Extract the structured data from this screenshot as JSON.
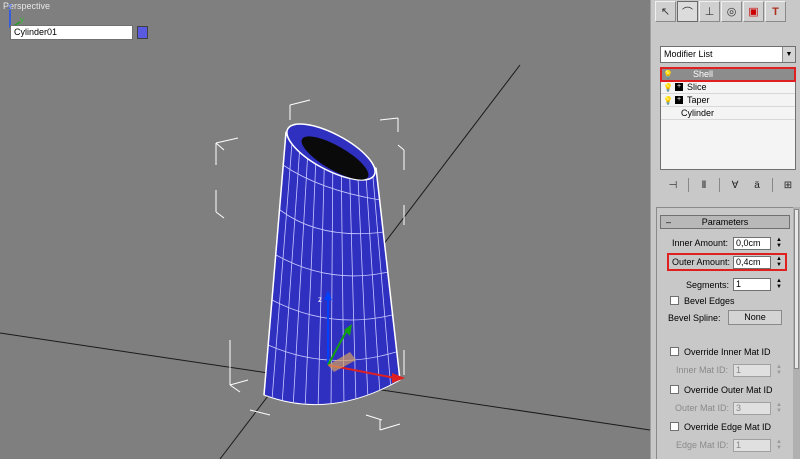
{
  "viewport": {
    "label": "Perspective",
    "axes": {
      "x": "x",
      "y": "y",
      "z": "z"
    }
  },
  "command_panel": {
    "tabs": [
      {
        "name": "create",
        "icon": "cursor-icon"
      },
      {
        "name": "modify",
        "icon": "bend-icon"
      },
      {
        "name": "hierarchy",
        "icon": "hierarchy-icon"
      },
      {
        "name": "motion",
        "icon": "motion-icon"
      },
      {
        "name": "display",
        "icon": "display-icon"
      },
      {
        "name": "utilities",
        "icon": "hammer-icon"
      }
    ],
    "object_name": "Cylinder01",
    "object_color": "#5a5ae0",
    "modifier_list_label": "Modifier List",
    "stack": [
      {
        "label": "Shell",
        "selected": true
      },
      {
        "label": "Slice"
      },
      {
        "label": "Taper"
      },
      {
        "label": "Cylinder"
      }
    ]
  },
  "parameters": {
    "title": "Parameters",
    "inner_amount": {
      "label": "Inner Amount:",
      "value": "0,0cm"
    },
    "outer_amount": {
      "label": "Outer Amount:",
      "value": "0,4cm"
    },
    "segments": {
      "label": "Segments:",
      "value": "1"
    },
    "bevel_edges": {
      "label": "Bevel Edges"
    },
    "bevel_spline": {
      "label": "Bevel Spline:",
      "button": "None"
    },
    "override_inner": {
      "label": "Override Inner Mat ID",
      "id_label": "Inner Mat ID:",
      "value": "1"
    },
    "override_outer": {
      "label": "Override Outer Mat ID",
      "id_label": "Outer Mat ID:",
      "value": "3"
    },
    "override_edge": {
      "label": "Override Edge Mat ID",
      "id_label": "Edge Mat ID:",
      "value": "1"
    }
  },
  "colors": {
    "viewport_bg": "#7f7f7f",
    "mesh": "#3a3ac8",
    "highlight": "#e02020"
  }
}
